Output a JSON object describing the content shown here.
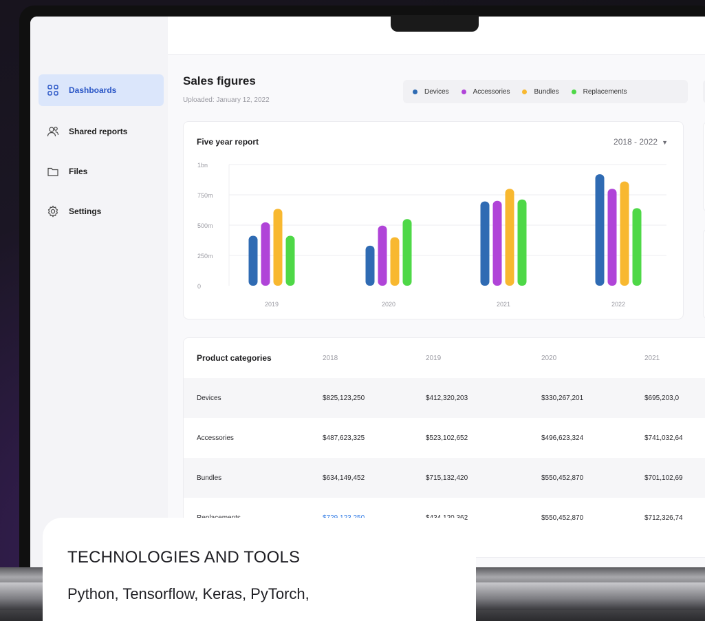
{
  "sidebar": {
    "items": [
      {
        "label": "Dashboards",
        "icon": "grid-icon",
        "active": true
      },
      {
        "label": "Shared reports",
        "icon": "users-icon",
        "active": false
      },
      {
        "label": "Files",
        "icon": "folder-icon",
        "active": false
      },
      {
        "label": "Settings",
        "icon": "gear-icon",
        "active": false
      }
    ]
  },
  "header": {
    "title": "Sales figures",
    "subtitle": "Uploaded: January 12, 2022"
  },
  "legend": [
    {
      "name": "Devices",
      "color": "#2f6bb3"
    },
    {
      "name": "Accessories",
      "color": "#b044d8"
    },
    {
      "name": "Bundles",
      "color": "#f8b830"
    },
    {
      "name": "Replacements",
      "color": "#4ed847"
    }
  ],
  "chart": {
    "title": "Five year report",
    "range": "2018 - 2022"
  },
  "chart_data": {
    "type": "bar",
    "categories": [
      "2019",
      "2020",
      "2021",
      "2022"
    ],
    "series": [
      {
        "name": "Devices",
        "color": "#2f6bb3",
        "values": [
          412,
          330,
          695,
          920
        ]
      },
      {
        "name": "Accessories",
        "color": "#b044d8",
        "values": [
          523,
          496,
          700,
          800
        ]
      },
      {
        "name": "Bundles",
        "color": "#f8b830",
        "values": [
          634,
          400,
          800,
          860
        ]
      },
      {
        "name": "Replacements",
        "color": "#4ed847",
        "values": [
          412,
          550,
          712,
          640
        ]
      }
    ],
    "y_ticks": [
      "0",
      "250m",
      "500m",
      "750m",
      "1bn"
    ],
    "ylim": [
      0,
      1000
    ],
    "grid": true
  },
  "table": {
    "columns": [
      "Product categories",
      "2018",
      "2019",
      "2020",
      "2021"
    ],
    "rows": [
      {
        "name": "Devices",
        "values": [
          "$825,123,250",
          "$412,320,203",
          "$330,267,201",
          "$695,203,0"
        ]
      },
      {
        "name": "Accessories",
        "values": [
          "$487,623,325",
          "$523,102,652",
          "$496,623,324",
          "$741,032,64"
        ]
      },
      {
        "name": "Bundles",
        "values": [
          "$634,149,452",
          "$715,132,420",
          "$550,452,870",
          "$701,102,69"
        ]
      },
      {
        "name": "Replacements",
        "values": [
          "$729,123,250",
          "$434,120,362",
          "$550,452,870",
          "$712,326,74"
        ]
      }
    ]
  },
  "overlay": {
    "title": "TECHNOLOGIES AND TOOLS",
    "text": "Python, Tensorflow, Keras, PyTorch,"
  }
}
